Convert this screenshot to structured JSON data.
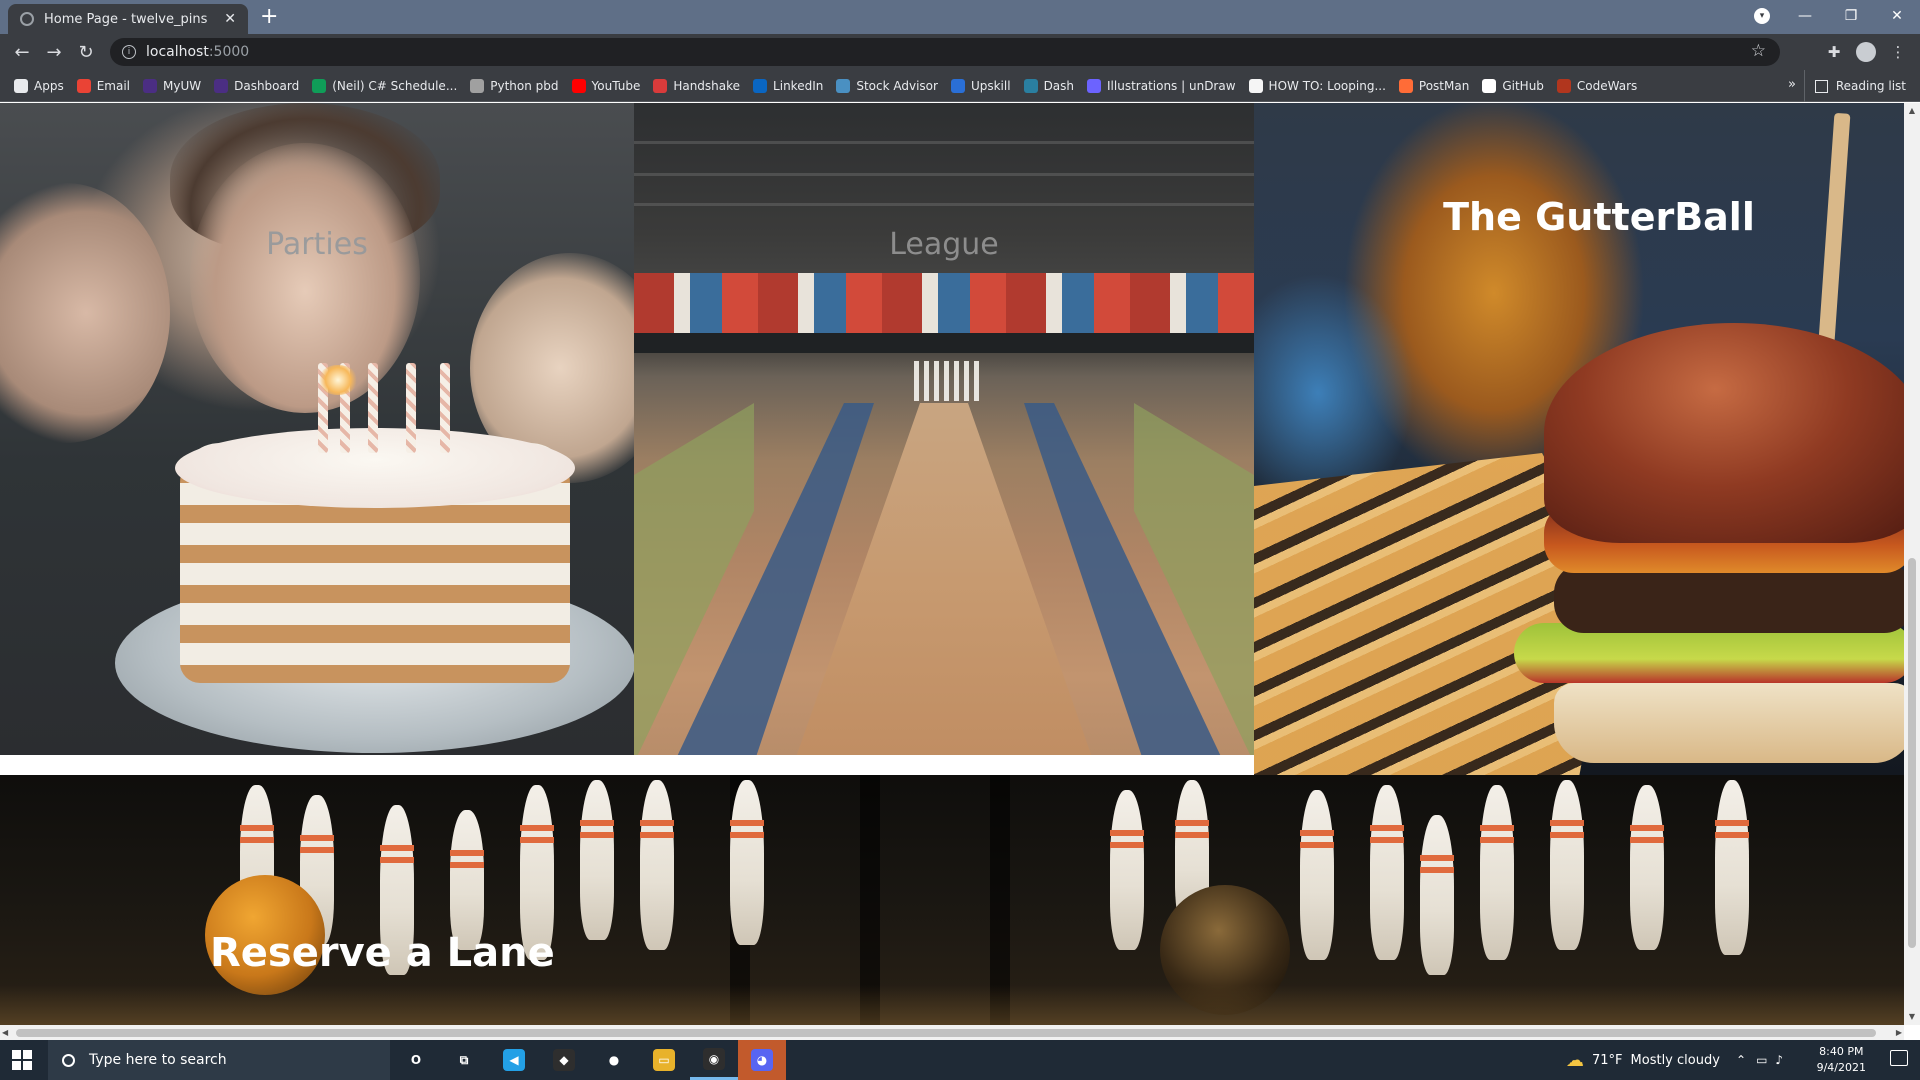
{
  "browser": {
    "tab_title": "Home Page - twelve_pins",
    "tab_close": "✕",
    "new_tab": "+",
    "url_host": "localhost",
    "url_port": ":5000",
    "window_controls": {
      "minimize": "—",
      "restore": "❐",
      "close": "✕"
    },
    "bookmarks": [
      {
        "label": "Apps",
        "icon": "apps-grid-icon",
        "color": "#e8eaed"
      },
      {
        "label": "Email",
        "icon": "gmail-icon",
        "color": "#ea4335"
      },
      {
        "label": "MyUW",
        "icon": "myuw-icon",
        "color": "#4b2e83"
      },
      {
        "label": "Dashboard",
        "icon": "uw-dashboard-icon",
        "color": "#4b2e83"
      },
      {
        "label": "(Neil) C# Schedule...",
        "icon": "sheets-icon",
        "color": "#0f9d58"
      },
      {
        "label": "Python pbd",
        "icon": "python-icon",
        "color": "#a0a0a0"
      },
      {
        "label": "YouTube",
        "icon": "youtube-icon",
        "color": "#ff0000"
      },
      {
        "label": "Handshake",
        "icon": "handshake-icon",
        "color": "#d93b3b"
      },
      {
        "label": "LinkedIn",
        "icon": "linkedin-icon",
        "color": "#0a66c2"
      },
      {
        "label": "Stock Advisor",
        "icon": "stock-advisor-icon",
        "color": "#4a90c2"
      },
      {
        "label": "Upskill",
        "icon": "upskill-icon",
        "color": "#2a6fd6"
      },
      {
        "label": "Dash",
        "icon": "dash-icon",
        "color": "#2a7fa0"
      },
      {
        "label": "Illustrations | unDraw",
        "icon": "undraw-icon",
        "color": "#6c63ff"
      },
      {
        "label": "HOW TO: Looping...",
        "icon": "w3-icon",
        "color": "#f5f5f5"
      },
      {
        "label": "PostMan",
        "icon": "postman-icon",
        "color": "#ff6c37"
      },
      {
        "label": "GitHub",
        "icon": "github-icon",
        "color": "#ffffff"
      },
      {
        "label": "CodeWars",
        "icon": "codewars-icon",
        "color": "#b1361e"
      }
    ],
    "bookmarks_more": "»",
    "reading_list": "Reading list"
  },
  "page": {
    "panels": [
      {
        "id": "parties",
        "heading": "Parties"
      },
      {
        "id": "league",
        "heading": "League"
      },
      {
        "id": "gutterball",
        "heading": "The GutterBall"
      },
      {
        "id": "reserve",
        "heading": "Reserve a Lane"
      }
    ]
  },
  "taskbar": {
    "search_placeholder": "Type here to search",
    "weather_temp": "71°F",
    "weather_desc": "Mostly cloudy",
    "time": "8:40 PM",
    "date": "9/4/2021",
    "apps": [
      {
        "icon": "cortana-icon",
        "label": "O"
      },
      {
        "icon": "task-view-icon",
        "label": "⧉"
      },
      {
        "icon": "vscode-icon",
        "label": "◀"
      },
      {
        "icon": "git-icon",
        "label": "◆"
      },
      {
        "icon": "paint-icon",
        "label": "●"
      },
      {
        "icon": "file-explorer-icon",
        "label": "▭"
      },
      {
        "icon": "chrome-icon",
        "label": "◉"
      },
      {
        "icon": "discord-icon",
        "label": "◕"
      }
    ]
  }
}
